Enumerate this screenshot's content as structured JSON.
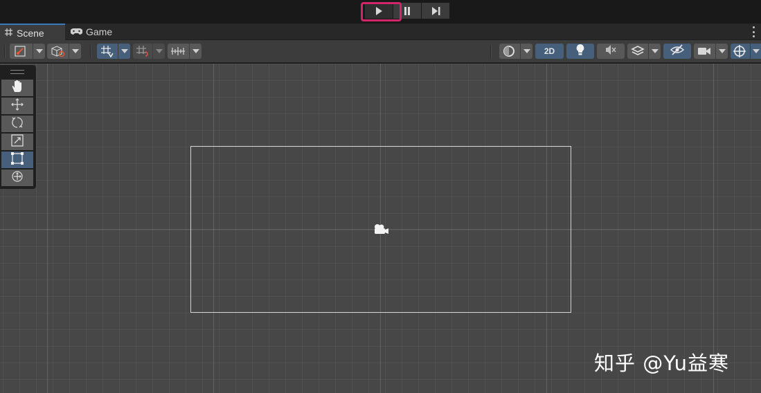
{
  "colors": {
    "play_highlight": "#d4246a",
    "accent_active": "#46607c",
    "tab_accent": "#3a79bb"
  },
  "playbar": {
    "buttons": [
      {
        "icon": "play-icon",
        "state": "highlighted"
      },
      {
        "icon": "pause-icon"
      },
      {
        "icon": "step-icon"
      }
    ]
  },
  "tabs": [
    {
      "label": "Scene",
      "icon": "scene-grid-icon",
      "active": true
    },
    {
      "label": "Game",
      "icon": "gamepad-icon",
      "active": false
    }
  ],
  "toolbar": {
    "mode_2d_label": "2D",
    "left_buttons": [
      "tool-handle-position-icon",
      "pivot-orientation-icon",
      "grid-snap-icon",
      "increment-snap-icon",
      "ruler-snap-icon"
    ],
    "right_buttons": [
      "draw-mode-icon",
      "2d-toggle",
      "lighting-icon",
      "audio-mute-icon",
      "effects-icon",
      "scene-visibility-icon",
      "camera-icon",
      "gizmos-icon"
    ]
  },
  "tool_palette": {
    "tools": [
      "hand-tool-icon",
      "move-tool-icon",
      "rotate-tool-icon",
      "scale-tool-icon",
      "rect-tool-icon",
      "transform-tool-icon"
    ],
    "active_tool": "rect-tool-icon"
  },
  "watermark": "知乎 @Yu益寒"
}
